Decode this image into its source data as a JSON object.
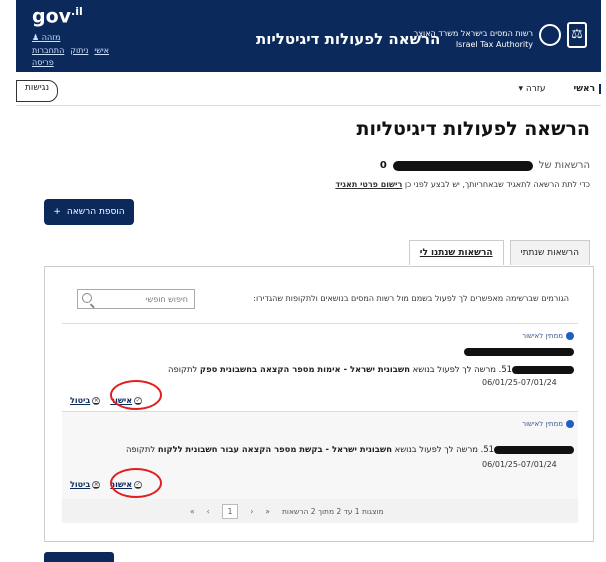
{
  "header": {
    "site": "gov",
    "site_suffix": ".il",
    "title": "הרשאה לפעולות דיגיטליות",
    "user_link": "מזהה",
    "links": [
      "אישי",
      "ניתוק",
      "התחברות"
    ],
    "logout": "פריסה",
    "authority_he": "רשות המסים בישראל משרד האוצר",
    "authority_en": "Israel Tax Authority"
  },
  "nav": {
    "back": "נגישות",
    "home": "ראשי",
    "help": "עזרה ▾"
  },
  "page": {
    "title": "הרשאה לפעולות דיגיטליות",
    "permissions_of": "הרשאות של",
    "permissions_value": "0",
    "notice_prefix": "כדי לתת הרשאה לתאגיד שבאחריותך, יש לבצע לפני כן",
    "notice_link": "רישום פרטי תאגיד",
    "add_button": "הוספת הרשאה",
    "add_plus": "+"
  },
  "tabs": [
    {
      "label": "הרשאות שנתתי",
      "active": false
    },
    {
      "label": "הרשאות שנתנו לי",
      "active": true
    }
  ],
  "panel": {
    "filter_text": "הגורמים שברשימה מאפשרים לך לפעול בשמם מול רשות המסים בנושאים ולתקופות שהגדירו:",
    "search_placeholder": "חיפוש חופשי"
  },
  "items": [
    {
      "status": "ממתין לאישור",
      "number": "51",
      "prefix": ". מרשה לך לפעול בנושא",
      "subject": "חשבונית ישראל - אימות מספר הקצאה בחשבונית",
      "role": "ספק",
      "suffix": "לתקופה",
      "dates": "06/01/25-07/01/24",
      "approve": "אישור",
      "cancel": "ביטול"
    },
    {
      "status": "ממתין לאישור",
      "number": "51",
      "prefix": ". מרשה לך לפעול בנושא",
      "subject": "חשבונית ישראל - בקשת מספר הקצאה עבור חשבונית",
      "role": "ללקוח",
      "suffix": "לתקופה",
      "dates": "06/01/25-07/01/24",
      "approve": "אישור",
      "cancel": "ביטול"
    }
  ],
  "pager": {
    "summary": "מוצגות 1 עד 2 מתוך 2 הרשאות",
    "first": "«",
    "prev": "‹",
    "current": "1",
    "next": "›",
    "last": "»"
  }
}
